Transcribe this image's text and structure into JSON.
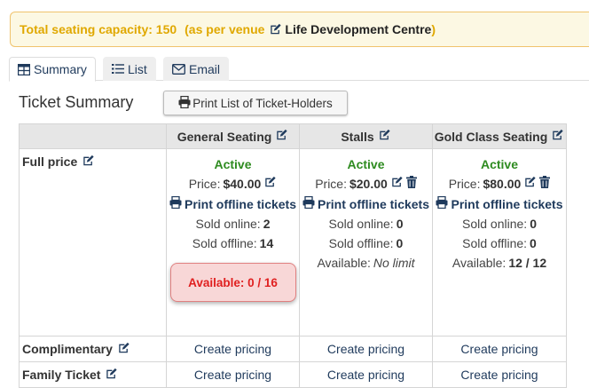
{
  "banner": {
    "label": "Total seating capacity: 150",
    "as_per": "(as per venue",
    "venue": "Life Development Centre",
    "close_paren": ")"
  },
  "tabs": [
    {
      "label": "Summary",
      "icon": "table-icon",
      "active": true
    },
    {
      "label": "List",
      "icon": "list-icon",
      "active": false
    },
    {
      "label": "Email",
      "icon": "envelope-icon",
      "active": false
    }
  ],
  "ticket_summary": {
    "title": "Ticket Summary",
    "print_button": "Print List of Ticket-Holders"
  },
  "columns": [
    "General Seating",
    "Stalls",
    "Gold Class Seating"
  ],
  "rows": [
    {
      "label": "Full price"
    },
    {
      "label": "Complimentary"
    },
    {
      "label": "Family Ticket"
    }
  ],
  "full_price_cells": [
    {
      "status": "Active",
      "price_label": "Price:",
      "price": "$40.00",
      "print_offline": "Print offline tickets",
      "sold_online_label": "Sold online:",
      "sold_online": "2",
      "sold_offline_label": "Sold offline:",
      "sold_offline": "14",
      "available_label": "Available:",
      "available": "0 / 16"
    },
    {
      "status": "Active",
      "price_label": "Price:",
      "price": "$20.00",
      "print_offline": "Print offline tickets",
      "sold_online_label": "Sold online:",
      "sold_online": "0",
      "sold_offline_label": "Sold offline:",
      "sold_offline": "0",
      "available_label": "Available:",
      "available": "No limit"
    },
    {
      "status": "Active",
      "price_label": "Price:",
      "price": "$80.00",
      "print_offline": "Print offline tickets",
      "sold_online_label": "Sold online:",
      "sold_online": "0",
      "sold_offline_label": "Sold offline:",
      "sold_offline": "0",
      "available_label": "Available:",
      "available": "12 / 12"
    }
  ],
  "create_pricing": "Create pricing",
  "colors": {
    "banner_bg": "#fcf8e3",
    "banner_text": "#e0a800",
    "active_green": "#2e8b20",
    "link_navy": "#1f3a5c",
    "sold_out_red": "#e02020"
  }
}
